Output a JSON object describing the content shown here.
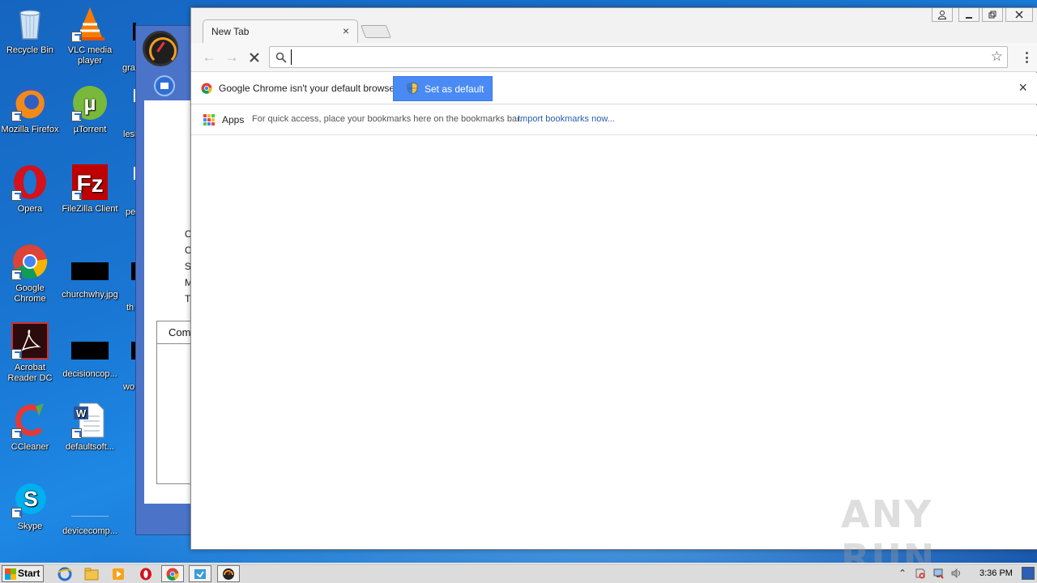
{
  "desktop": {
    "icons": [
      {
        "label": "Recycle Bin"
      },
      {
        "label": "VLC media player"
      },
      {
        "label": "Mozilla Firefox"
      },
      {
        "label": "µTorrent"
      },
      {
        "label": "Opera"
      },
      {
        "label": "FileZilla Client"
      },
      {
        "label": "Google Chrome"
      },
      {
        "label": "churchwhy.jpg"
      },
      {
        "label": "Acrobat Reader DC"
      },
      {
        "label": "decisioncop..."
      },
      {
        "label": "CCleaner"
      },
      {
        "label": "defaultsoft..."
      },
      {
        "label": "Skype"
      },
      {
        "label": "devicecomp..."
      }
    ],
    "partial_labels": [
      "gra",
      "lesl",
      "pe",
      "th",
      "wo"
    ]
  },
  "background_app": {
    "visible_letters": [
      "O",
      "C",
      "S",
      "M",
      "T"
    ],
    "combo_header": "Com"
  },
  "chrome": {
    "tab": {
      "title": "New Tab",
      "close": "×"
    },
    "omnibox": {
      "value": "",
      "placeholder": ""
    },
    "infobar": {
      "message": "Google Chrome isn't your default browser.",
      "button": "Set as default",
      "close": "×"
    },
    "bookmarks": {
      "apps_label": "Apps",
      "hint": "For quick access, place your bookmarks here on the bookmarks bar.",
      "import_link": "Import bookmarks now..."
    }
  },
  "watermark": "ANY RUN",
  "taskbar": {
    "start_label": "Start",
    "clock": "3:36 PM"
  },
  "colors": {
    "accent": "#4a8af4",
    "desktop": "#1976d2",
    "link": "#2a5db0"
  }
}
